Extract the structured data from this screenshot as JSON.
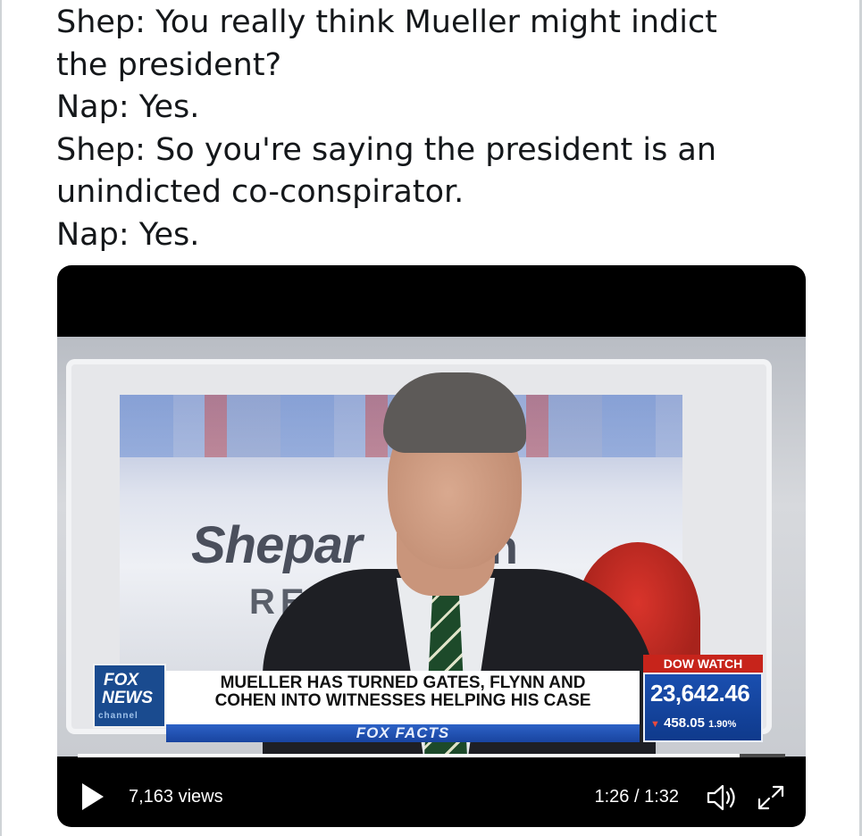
{
  "tweet": {
    "lines": [
      "Shep: You really think Mueller might indict",
      "the president?",
      "Nap: Yes.",
      "Shep: So you're saying the president is an",
      "unindicted co-conspirator.",
      "Nap: Yes."
    ]
  },
  "video": {
    "frame": {
      "show_title_left": "Shepar",
      "show_title_right": "ith",
      "show_subtitle": "RE"
    },
    "chyron": {
      "logo_line1": "FOX",
      "logo_line2": "NEWS",
      "logo_line3": "channel",
      "headline_line1": "MUELLER HAS TURNED GATES, FLYNN AND",
      "headline_line2": "COHEN INTO WITNESSES HELPING HIS CASE",
      "bar_text": "FOX FACTS"
    },
    "dow": {
      "header": "DOW WATCH",
      "value": "23,642.46",
      "change": "458.05",
      "change_pct": "1.90%",
      "direction": "down",
      "down_color": "#e84a3d"
    },
    "controls": {
      "views": "7,163 views",
      "time": "1:26 / 1:32",
      "progress": 0.935,
      "icons": [
        "play-icon",
        "volume-icon",
        "fullscreen-icon"
      ]
    }
  }
}
